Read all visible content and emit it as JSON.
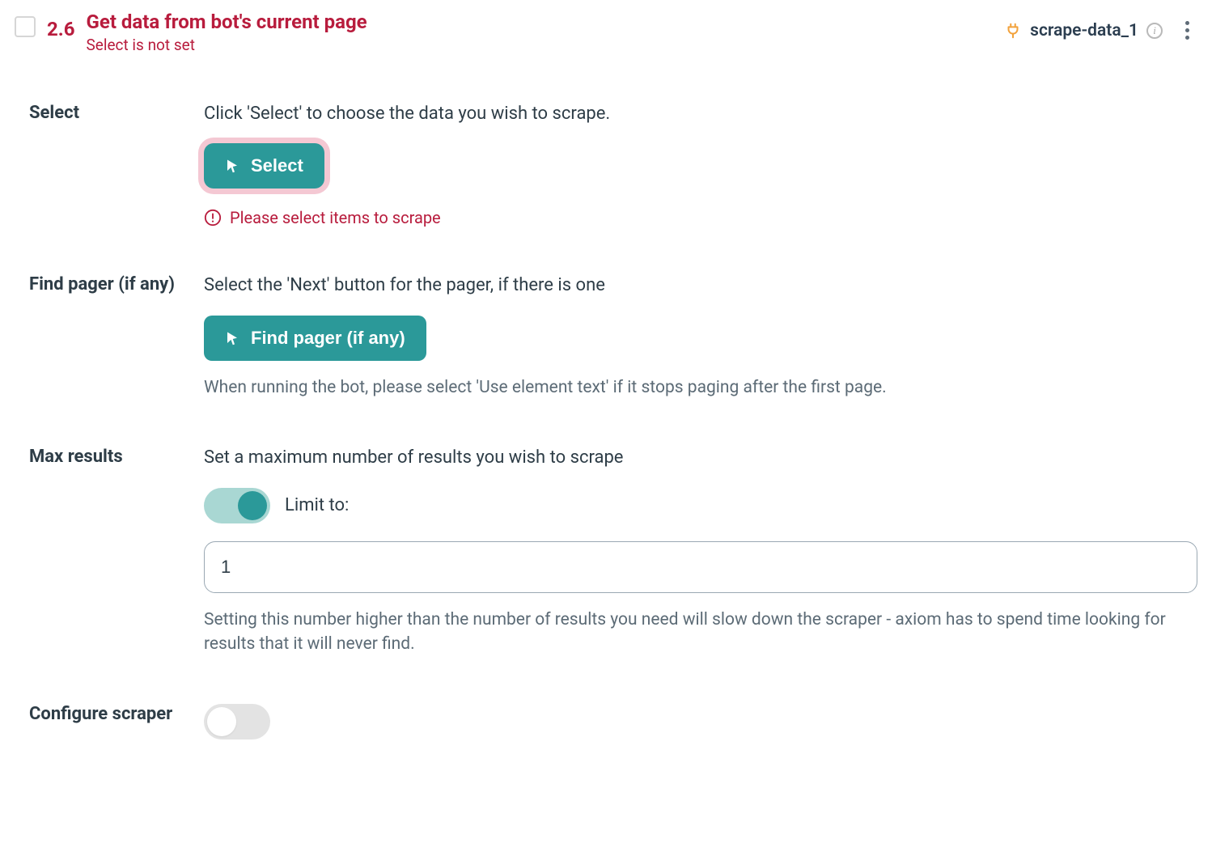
{
  "header": {
    "step_number": "2.6",
    "title": "Get data from bot's current page",
    "subtitle_error": "Select is not set",
    "stage_name": "scrape-data_1"
  },
  "select": {
    "label": "Select",
    "desc": "Click 'Select' to choose the data you wish to scrape.",
    "button": "Select",
    "error": "Please select items to scrape"
  },
  "pager": {
    "label": "Find pager (if any)",
    "desc": "Select the 'Next' button for the pager, if there is one",
    "button": "Find pager (if any)",
    "hint": "When running the bot, please select 'Use element text' if it stops paging after the first page."
  },
  "max_results": {
    "label": "Max results",
    "desc": "Set a maximum number of results you wish to scrape",
    "toggle_label": "Limit to:",
    "value": "1",
    "hint": "Setting this number higher than the number of results you need will slow down the scraper - axiom has to spend time looking for results that it will never find."
  },
  "configure": {
    "label": "Configure scraper"
  }
}
